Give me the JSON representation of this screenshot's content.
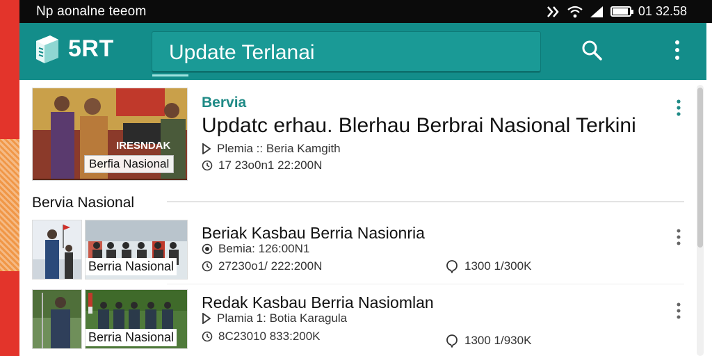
{
  "status_bar": {
    "left_text": "Np aonalne teeom",
    "time": "01 32.58",
    "battery_level": 0.85
  },
  "app_bar": {
    "brand": "5RT",
    "title": "Update Terlanai",
    "icons": [
      "logo-book-icon",
      "search-icon",
      "more-vert-icon"
    ]
  },
  "featured": {
    "category": "Bervia",
    "title": "Updatc erhau. Blerhau Berbrai Nasional Terkini",
    "author": "Plemia :: Beria Kamgith",
    "time": "17 23o0n1 22:200N",
    "image_label": "Berfia Nasional",
    "image_banner": "IRESNDAK"
  },
  "section": {
    "title": "Bervia Nasional"
  },
  "articles": [
    {
      "title": "Beriak Kasbau Berria Nasionria",
      "author": "Bemia: 126:00N1",
      "time": "27230o1/ 222:200N",
      "views": "1300 1/300K",
      "image_label": "Berria Nasional"
    },
    {
      "title": "Redak Kasbau Berria Nasiomlan",
      "author": "Plamia 1: Botia Karagula",
      "time": "8C23010 833:200K",
      "views": "1300 1/930K",
      "image_label": "Berria Nasional"
    }
  ],
  "colors": {
    "accent": "#138d8a",
    "category": "#1f8a86",
    "strip": "#e3342b"
  }
}
